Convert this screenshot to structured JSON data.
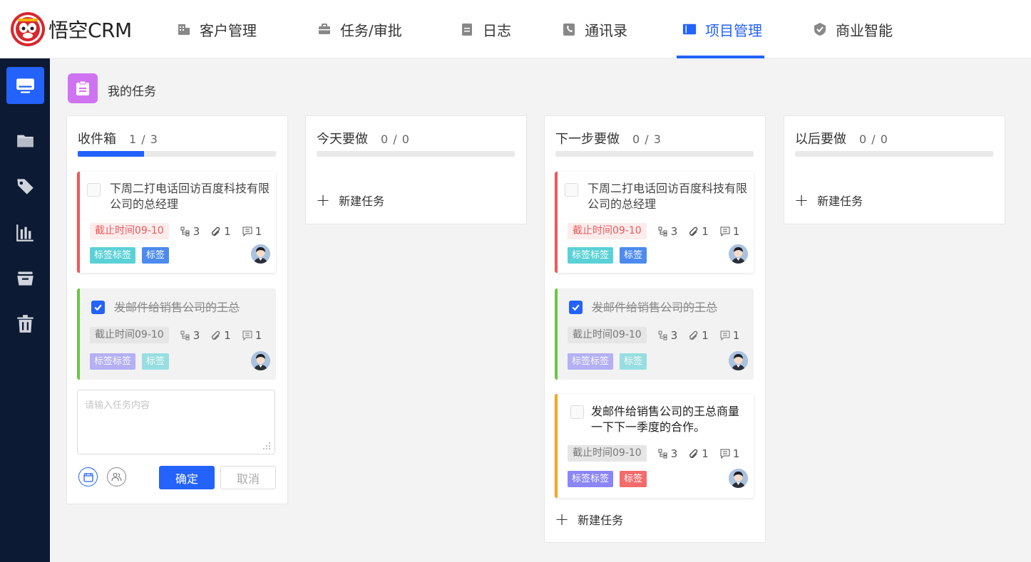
{
  "app": {
    "logo_text": "悟空CRM"
  },
  "nav": {
    "items": [
      {
        "label": "客户管理",
        "icon": "building-icon"
      },
      {
        "label": "任务/审批",
        "icon": "briefcase-icon"
      },
      {
        "label": "日志",
        "icon": "document-icon"
      },
      {
        "label": "通讯录",
        "icon": "phone-book-icon"
      },
      {
        "label": "项目管理",
        "icon": "kanban-icon",
        "active": true
      },
      {
        "label": "商业智能",
        "icon": "shield-check-icon"
      }
    ]
  },
  "sidebar": {
    "items": [
      {
        "icon": "monitor-icon",
        "active": true
      },
      {
        "icon": "folder-icon"
      },
      {
        "icon": "tag-icon"
      },
      {
        "icon": "bar-chart-icon"
      },
      {
        "icon": "archive-icon"
      },
      {
        "icon": "trash-icon"
      }
    ]
  },
  "page": {
    "title": "我的任务"
  },
  "colors": {
    "accent": "#2362fb",
    "red": "#e95b5b",
    "green": "#6cc644",
    "orange": "#f5a623",
    "teal_tag": "#5ad1d6",
    "blue_tag": "#4d8af0",
    "purple_tag": "#8b85f5",
    "red_tag": "#f36b6b"
  },
  "columns": [
    {
      "title": "收件箱",
      "count": "1 / 3",
      "progress": 0.333,
      "cards": [
        {
          "title": "下周二打电话回访百度科技有限公司的总经理",
          "done": false,
          "color": "red",
          "deadline": "截止时间09-10",
          "subtasks": "3",
          "attachments": "1",
          "comments": "1",
          "tags": [
            "标签标签",
            "标签"
          ]
        },
        {
          "title": "发邮件给销售公司的王总",
          "done": true,
          "color": "green",
          "deadline": "截止时间09-10",
          "subtasks": "3",
          "attachments": "1",
          "comments": "1",
          "tags": [
            "标签标签",
            "标签"
          ]
        }
      ],
      "editor": {
        "placeholder": "请输入任务内容",
        "confirm": "确定",
        "cancel": "取消"
      }
    },
    {
      "title": "今天要做",
      "count": "0 / 0",
      "progress": 0,
      "new_task": "新建任务"
    },
    {
      "title": "下一步要做",
      "count": "0 / 3",
      "progress": 0,
      "cards": [
        {
          "title": "下周二打电话回访百度科技有限公司的总经理",
          "done": false,
          "color": "red",
          "deadline": "截止时间09-10",
          "subtasks": "3",
          "attachments": "1",
          "comments": "1",
          "tags": [
            "标签标签",
            "标签"
          ]
        },
        {
          "title": "发邮件给销售公司的王总",
          "done": true,
          "color": "green",
          "deadline": "截止时间09-10",
          "subtasks": "3",
          "attachments": "1",
          "comments": "1",
          "tags": [
            "标签标签",
            "标签"
          ]
        },
        {
          "title": "发邮件给销售公司的王总商量一下下一季度的合作。",
          "done": false,
          "color": "orange",
          "deadline": "截止时间09-10",
          "subtasks": "3",
          "attachments": "1",
          "comments": "1",
          "tags": [
            "标签标签",
            "标签"
          ]
        }
      ],
      "new_task": "新建任务"
    },
    {
      "title": "以后要做",
      "count": "0 / 0",
      "progress": 0,
      "new_task": "新建任务"
    }
  ]
}
